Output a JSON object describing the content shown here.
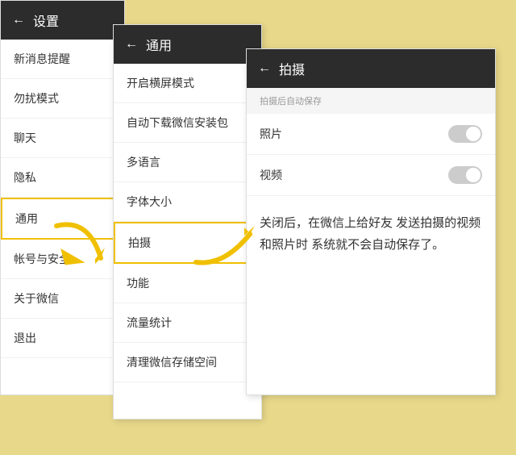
{
  "settings": {
    "header": {
      "back_label": "←",
      "title": "设置"
    },
    "menu_items": [
      {
        "id": "notifications",
        "label": "新消息提醒"
      },
      {
        "id": "dnd",
        "label": "勿扰模式"
      },
      {
        "id": "chat",
        "label": "聊天"
      },
      {
        "id": "privacy",
        "label": "隐私"
      },
      {
        "id": "general",
        "label": "通用",
        "active": true
      },
      {
        "id": "account",
        "label": "帐号与安全"
      },
      {
        "id": "about",
        "label": "关于微信"
      },
      {
        "id": "logout",
        "label": "退出"
      }
    ]
  },
  "general": {
    "header": {
      "back_label": "←",
      "title": "通用"
    },
    "menu_items": [
      {
        "id": "landscape",
        "label": "开启横屏模式"
      },
      {
        "id": "download",
        "label": "自动下载微信安装包"
      },
      {
        "id": "language",
        "label": "多语言"
      },
      {
        "id": "fontsize",
        "label": "字体大小"
      },
      {
        "id": "camera",
        "label": "拍摄",
        "highlighted": true
      },
      {
        "id": "function",
        "label": "功能"
      },
      {
        "id": "traffic",
        "label": "流量统计"
      },
      {
        "id": "storage",
        "label": "清理微信存储空间"
      }
    ]
  },
  "camera": {
    "header": {
      "back_label": "←",
      "title": "拍摄"
    },
    "section_title": "拍摄后自动保存",
    "toggle_items": [
      {
        "id": "photo",
        "label": "照片",
        "enabled": false
      },
      {
        "id": "video",
        "label": "视频",
        "enabled": false
      }
    ],
    "description": "关闭后，在微信上给好友\n发送拍摄的视频和照片时\n系统就不会自动保存了。"
  }
}
